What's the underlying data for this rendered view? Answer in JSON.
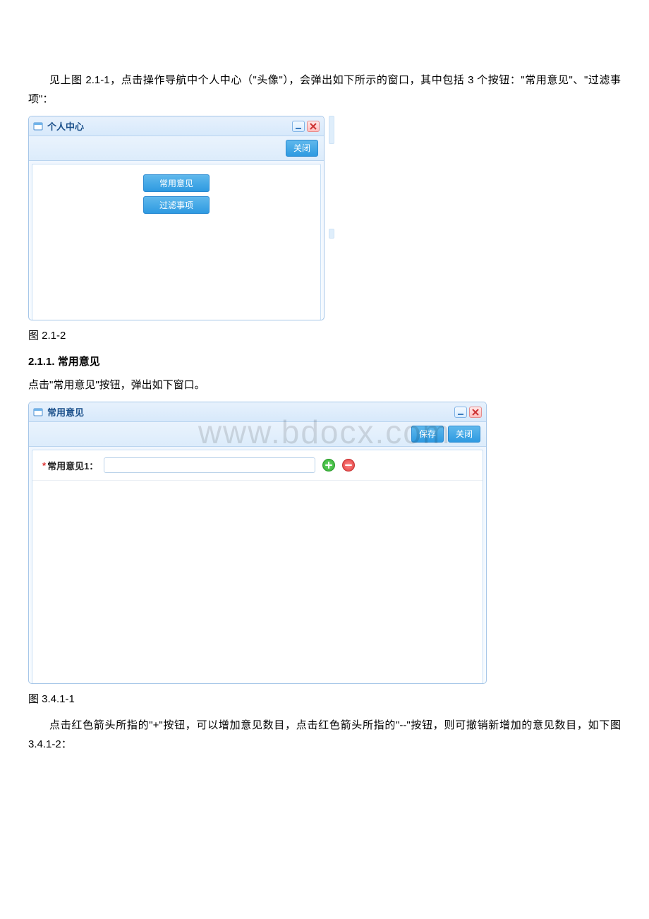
{
  "text": {
    "intro": "见上图 2.1-1，点击操作导航中个人中心（\"头像\"），会弹出如下所示的窗口，其中包括 3 个按钮：\"常用意见\"、\"过滤事项\"：",
    "caption1": "图 2.1-2",
    "heading": "2.1.1. 常用意见",
    "para2": "点击\"常用意见\"按钮，弹出如下窗口。",
    "caption2": "图 3.4.1-1",
    "para3": "点击红色箭头所指的\"+\"按钮，可以增加意见数目，点击红色箭头所指的\"--\"按钮，则可撤销新增加的意见数目，如下图 3.4.1-2："
  },
  "window1": {
    "title": "个人中心",
    "close_btn": "关闭",
    "items": {
      "common_opinion": "常用意见",
      "filter_items": "过滤事项"
    }
  },
  "window2": {
    "title": "常用意见",
    "save_btn": "保存",
    "close_btn": "关闭",
    "field": {
      "label": "常用意见1：",
      "required_marker": "*"
    }
  },
  "watermark": "www.bdocx.com"
}
